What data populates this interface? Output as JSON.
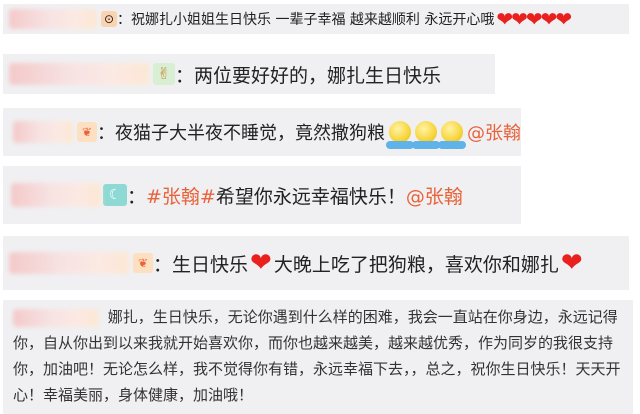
{
  "comments": [
    {
      "id": "c1",
      "icon": "sticker-icon",
      "sep": "：",
      "text": "祝娜扎小姐姐生日快乐 一辈子幸福 越来越顺利 永远开心哦",
      "trailing_icon": "heart-icon",
      "trailing_count": 5
    },
    {
      "id": "c2",
      "icon": "victory-hand-icon",
      "sep": "：",
      "text": "两位要好好的，娜扎生日快乐"
    },
    {
      "id": "c3",
      "icon": "badge-icon",
      "sep": "：",
      "text": "夜猫子大半夜不睡觉，竟然撒狗粮",
      "emoji_icon": "smiley-face-icon",
      "emoji_count": 3,
      "mention": "@张翰"
    },
    {
      "id": "c4",
      "icon": "moon-icon",
      "sep": "：",
      "topic": "#张翰#",
      "text": " 希望你永远幸福快乐！",
      "mention": "@张翰"
    },
    {
      "id": "c5",
      "icon": "badge-icon",
      "sep": "：",
      "text_a": "生日快乐",
      "text_b": "大晚上吃了把狗粮，喜欢你和娜扎",
      "heart_icon": "heart-icon"
    }
  ],
  "paragraph": {
    "text": "娜扎，生日快乐，无论你遇到什么样的困难，我会一直站在你身边，永远记得你，自从你出到以来我就开始喜欢你，而你也越来越美，越来越优秀，作为同岁的我很支持你，加油吧！无论怎么样，我不觉得你有错，永远幸福下去，，总之，祝你生日快乐！天天开心！幸福美丽，身体健康，加油哦！"
  },
  "colors": {
    "background": "#ffffff",
    "comment_bg": "#f0f0f2",
    "accent_orange": "#e8623a",
    "heart_red": "#e8211f"
  }
}
